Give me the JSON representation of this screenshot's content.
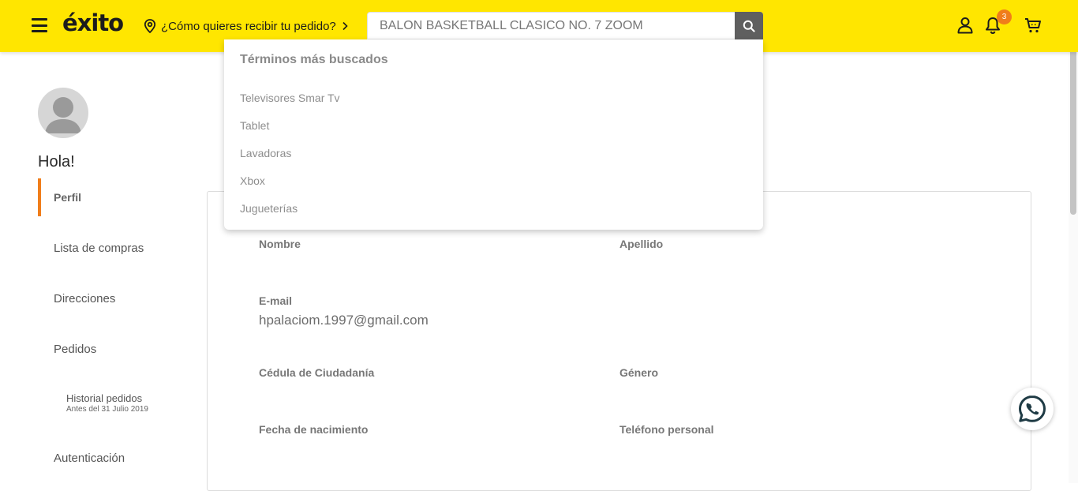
{
  "header": {
    "logo_text": "éxito",
    "delivery_prompt": "¿Cómo quieres recibir tu pedido?",
    "search": {
      "value": "BALON BASKETBALL CLASICO NO. 7 ZOOM"
    },
    "notifications_count": "3",
    "colors": {
      "background": "#FFE600",
      "badge": "#f07d1a",
      "search_button": "#5f5f5f"
    },
    "icons": [
      "menu-icon",
      "location-pin-icon",
      "chevron-right-icon",
      "search-icon",
      "user-icon",
      "bell-icon",
      "cart-icon"
    ]
  },
  "search_dropdown": {
    "title": "Términos más buscados",
    "items": [
      "Televisores Smar Tv",
      "Tablet",
      "Lavadoras",
      "Xbox",
      "Jugueterías"
    ]
  },
  "sidebar": {
    "greeting": "Hola!",
    "items": [
      {
        "label": "Perfil"
      },
      {
        "label": "Lista de compras"
      },
      {
        "label": "Direcciones"
      },
      {
        "label": "Pedidos"
      },
      {
        "label": "Autenticación"
      }
    ],
    "sub_item": {
      "label": "Historial pedidos",
      "note": "Antes del 31 Julio 2019"
    },
    "active_color": "#f07d1a"
  },
  "profile_form": {
    "first_name_label": "Nombre",
    "last_name_label": "Apellido",
    "email_label": "E-mail",
    "email_value": "hpalaciom.1997@gmail.com",
    "id_label": "Cédula de Ciudadanía",
    "gender_label": "Género",
    "birth_label": "Fecha de nacimiento",
    "phone_label": "Teléfono personal"
  }
}
